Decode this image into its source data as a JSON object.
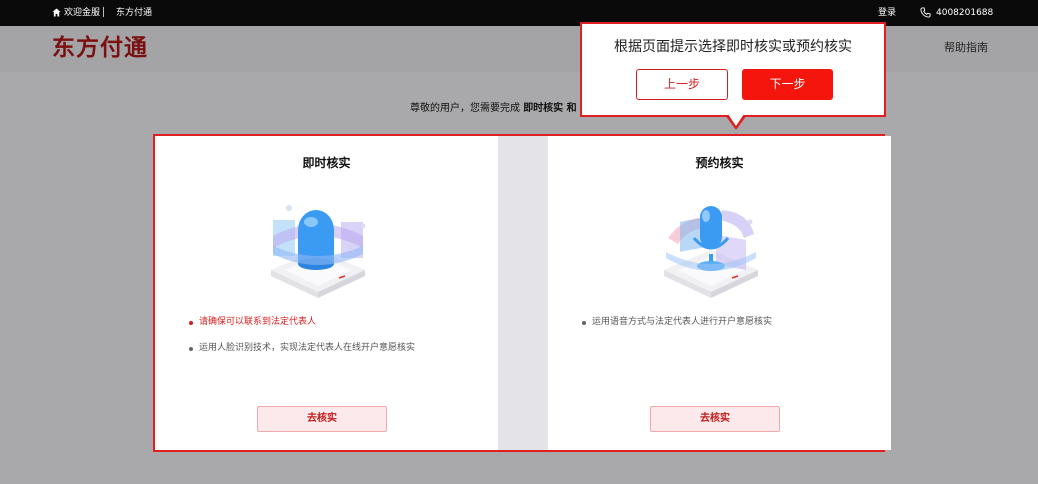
{
  "topbar": {
    "welcome": "欢迎金服",
    "brand": "东方付通",
    "login": "登录",
    "phone": "4008201688"
  },
  "header": {
    "logo": "东方付通",
    "help": "帮助指南"
  },
  "notice": {
    "prefix": "尊敬的用户，您需要完成 ",
    "bold": "即时核实 和"
  },
  "cards": {
    "instant": {
      "title": "即时核实",
      "bullets": [
        "请确保可以联系到法定代表人",
        "运用人脸识别技术，实现法定代表人在线开户意愿核实"
      ],
      "button": "去核实"
    },
    "scheduled": {
      "title": "预约核实",
      "bullets": [
        "运用语音方式与法定代表人进行开户意愿核实"
      ],
      "button": "去核实"
    }
  },
  "tooltip": {
    "text": "根据页面提示选择即时核实或预约核实",
    "prev": "上一步",
    "next": "下一步"
  },
  "colors": {
    "accent": "#e02020",
    "brand": "#7a1010"
  }
}
